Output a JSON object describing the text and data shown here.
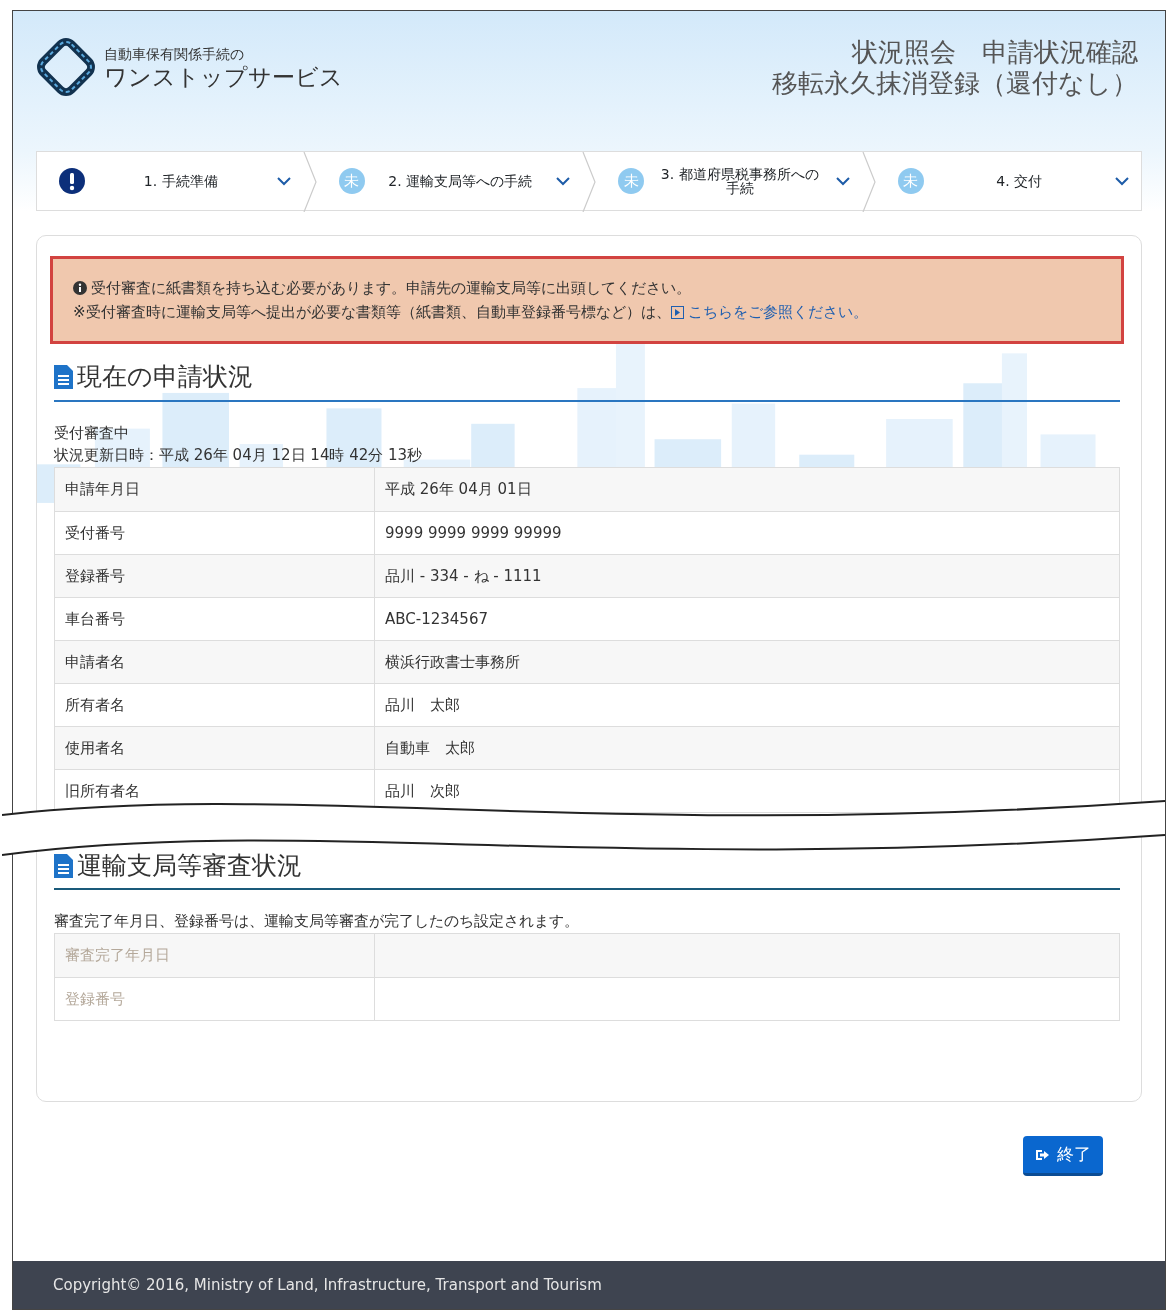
{
  "header": {
    "logo_caption": "自動車保有関係手続の",
    "logo_title": "ワンストップサービス",
    "title_lines": [
      "状況照会　申請状況確認",
      "移転永久抹消登録（還付なし）"
    ]
  },
  "steps": [
    {
      "kind": "alert",
      "label": "1. 手続準備",
      "expanded": false
    },
    {
      "kind": "pending",
      "badge": "未",
      "label": "2. 運輸支局等への手続",
      "expanded": false
    },
    {
      "kind": "pending",
      "badge": "未",
      "label": "3. 都道府県税事務所への手続",
      "expanded": false
    },
    {
      "kind": "pending",
      "badge": "未",
      "label": "4. 交付",
      "expanded": false
    }
  ],
  "alert": {
    "message": "受付審査に紙書類を持ち込む必要があります。申請先の運輸支局等に出頭してください。",
    "note": "※受付審査時に運輸支局等へ提出が必要な書類等（紙書類、自動車登録番号標など）は、",
    "link": "こちらをご参照ください。"
  },
  "current_status": {
    "heading": "現在の申請状況",
    "status": "受付審査中",
    "updated": "状況更新日時：平成 26年 04月 12日 14時 42分 13秒",
    "rows": [
      {
        "label": "申請年月日",
        "value": "平成 26年 04月 01日",
        "disabled": false
      },
      {
        "label": "受付番号",
        "value": "9999 9999 9999 99999",
        "disabled": false
      },
      {
        "label": "登録番号",
        "value": "品川 - 334 - ね - 1111",
        "disabled": false
      },
      {
        "label": "車台番号",
        "value": "ABC-1234567",
        "disabled": false
      },
      {
        "label": "申請者名",
        "value": "横浜行政書士事務所",
        "disabled": false
      },
      {
        "label": "所有者名",
        "value": "品川　太郎",
        "disabled": false
      },
      {
        "label": "使用者名",
        "value": "自動車　太郎",
        "disabled": false
      },
      {
        "label": "旧所有者名",
        "value": "品川　次郎",
        "disabled": false
      }
    ]
  },
  "review_status": {
    "heading": "運輸支局等審査状況",
    "note": "審査完了年月日、登録番号は、運輸支局等審査が完了したのち設定されます。",
    "rows": [
      {
        "label": "審査完了年月日",
        "value": "",
        "disabled": true
      },
      {
        "label": "登録番号",
        "value": "",
        "disabled": true
      }
    ]
  },
  "buttons": [
    {
      "label": "終了"
    }
  ],
  "footer": "Copyright© 2016, Ministry of Land, Infrastructure, Transport and Tourism"
}
